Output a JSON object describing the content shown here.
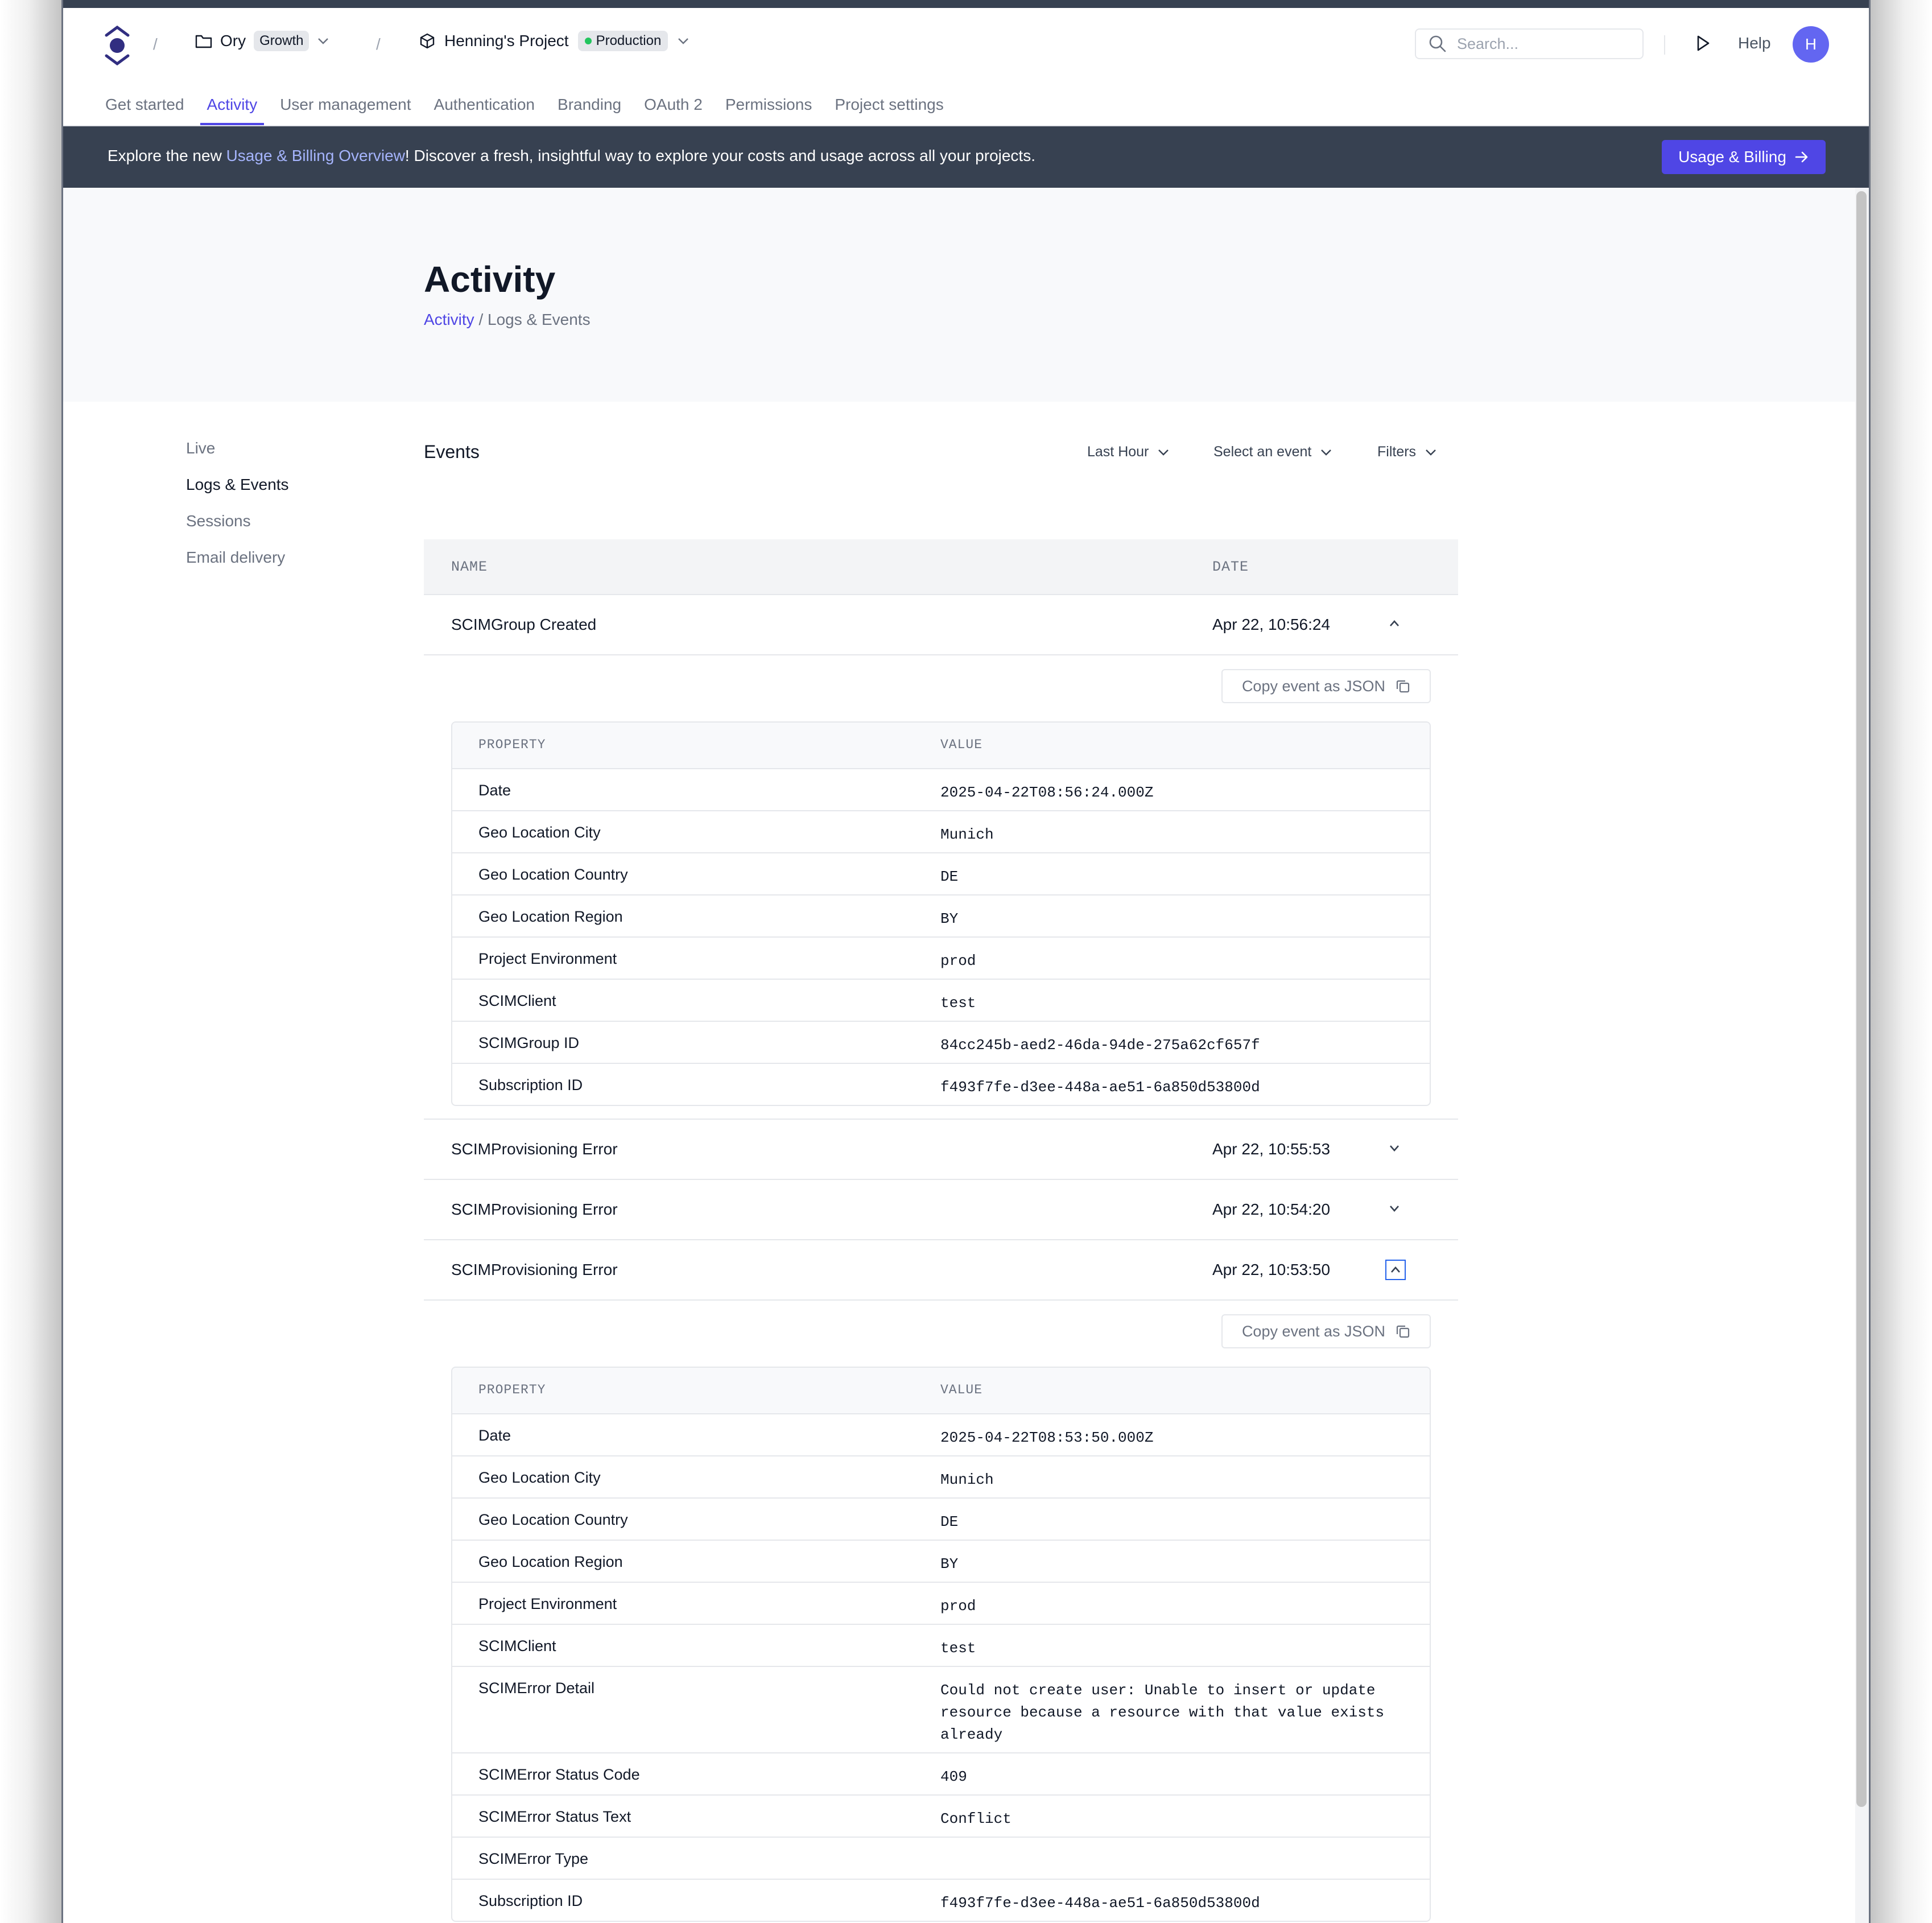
{
  "header": {
    "workspace": {
      "name": "Ory",
      "plan": "Growth"
    },
    "project": {
      "name": "Henning's Project",
      "env": "Production"
    },
    "search_placeholder": "Search...",
    "help": "Help",
    "avatar_initial": "H"
  },
  "tabs": [
    "Get started",
    "Activity",
    "User management",
    "Authentication",
    "Branding",
    "OAuth 2",
    "Permissions",
    "Project settings"
  ],
  "banner": {
    "prefix": "Explore the new ",
    "link": "Usage & Billing Overview",
    "suffix": "! Discover a fresh, insightful way to explore your costs and usage across all your projects.",
    "button": "Usage & Billing"
  },
  "page": {
    "title": "Activity",
    "breadcrumb_link": "Activity",
    "breadcrumb_sep": " / ",
    "breadcrumb_current": "Logs & Events"
  },
  "sidenav": [
    "Live",
    "Logs & Events",
    "Sessions",
    "Email delivery"
  ],
  "events": {
    "title": "Events",
    "filters": {
      "time": "Last Hour",
      "event": "Select an event",
      "filters": "Filters"
    },
    "col_name": "NAME",
    "col_date": "DATE",
    "prop_col": "PROPERTY",
    "value_col": "VALUE",
    "copy_label": "Copy event as JSON",
    "rows": [
      {
        "name": "SCIMGroup Created",
        "date": "Apr 22, 10:56:24",
        "expanded": true,
        "props": [
          {
            "k": "Date",
            "v": "2025-04-22T08:56:24.000Z"
          },
          {
            "k": "Geo Location City",
            "v": "Munich"
          },
          {
            "k": "Geo Location Country",
            "v": "DE"
          },
          {
            "k": "Geo Location Region",
            "v": "BY"
          },
          {
            "k": "Project Environment",
            "v": "prod"
          },
          {
            "k": "SCIMClient",
            "v": "test"
          },
          {
            "k": "SCIMGroup ID",
            "v": "84cc245b-aed2-46da-94de-275a62cf657f"
          },
          {
            "k": "Subscription ID",
            "v": "f493f7fe-d3ee-448a-ae51-6a850d53800d"
          }
        ]
      },
      {
        "name": "SCIMProvisioning Error",
        "date": "Apr 22, 10:55:53",
        "expanded": false
      },
      {
        "name": "SCIMProvisioning Error",
        "date": "Apr 22, 10:54:20",
        "expanded": false
      },
      {
        "name": "SCIMProvisioning Error",
        "date": "Apr 22, 10:53:50",
        "expanded": true,
        "props": [
          {
            "k": "Date",
            "v": "2025-04-22T08:53:50.000Z"
          },
          {
            "k": "Geo Location City",
            "v": "Munich"
          },
          {
            "k": "Geo Location Country",
            "v": "DE"
          },
          {
            "k": "Geo Location Region",
            "v": "BY"
          },
          {
            "k": "Project Environment",
            "v": "prod"
          },
          {
            "k": "SCIMClient",
            "v": "test"
          },
          {
            "k": "SCIMError Detail",
            "v": "Could not create user: Unable to insert or update resource because a resource with that value exists already"
          },
          {
            "k": "SCIMError Status Code",
            "v": "409"
          },
          {
            "k": "SCIMError Status Text",
            "v": "Conflict"
          },
          {
            "k": "SCIMError Type",
            "v": ""
          },
          {
            "k": "Subscription ID",
            "v": "f493f7fe-d3ee-448a-ae51-6a850d53800d"
          }
        ]
      }
    ]
  },
  "colors": {
    "accent": "#4f46e5",
    "banner_bg": "#374151",
    "status_green": "#22c55e"
  }
}
